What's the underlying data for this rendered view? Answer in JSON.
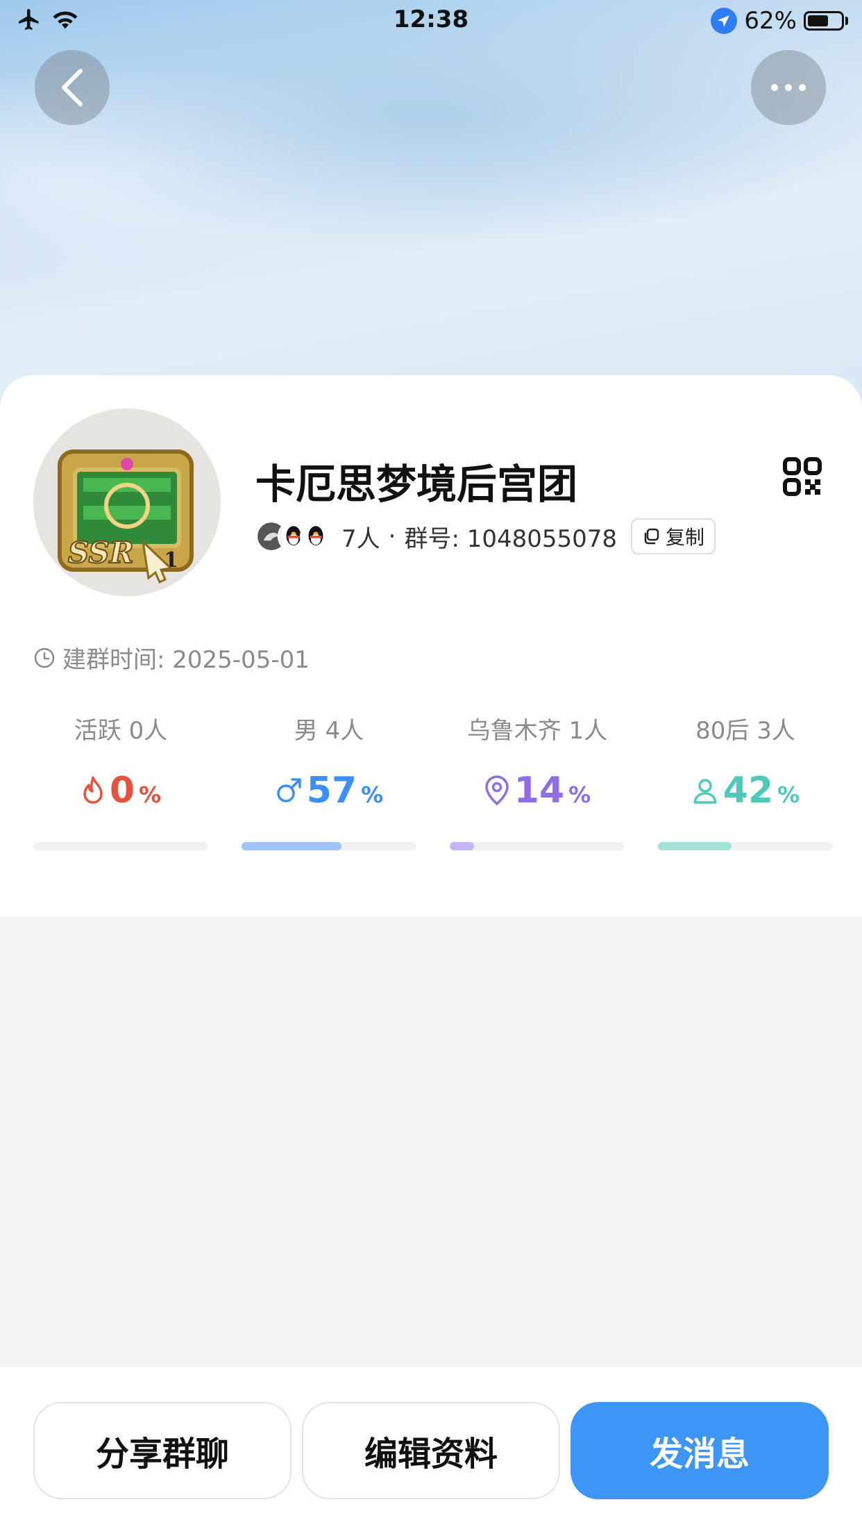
{
  "status_bar": {
    "time": "12:38",
    "battery": "62%",
    "battery_level": 0.62
  },
  "group": {
    "name": "卡厄思梦境后宫团",
    "member_count": "7人",
    "separator": "·",
    "group_id_label": "群号: 1048055078",
    "copy_label": "复制",
    "created_label": "建群时间: 2025-05-01",
    "avatar_badge": "SSR",
    "avatar_level": "1"
  },
  "stats": [
    {
      "label": "活跃 0人",
      "value": "0",
      "unit": "%",
      "icon": "fire-icon",
      "color": "#e5533d",
      "fill": 0.0
    },
    {
      "label": "男 4人",
      "value": "57",
      "unit": "%",
      "icon": "male-icon",
      "color": "#3d8ef5",
      "fill": 0.57,
      "bar_color": "#9fc2f7"
    },
    {
      "label": "乌鲁木齐 1人",
      "value": "14",
      "unit": "%",
      "icon": "location-pin-icon",
      "color": "#8e6ee6",
      "fill": 0.14,
      "bar_color": "#c6b5f4"
    },
    {
      "label": "80后 3人",
      "value": "42",
      "unit": "%",
      "icon": "person-icon",
      "color": "#4fcab8",
      "fill": 0.42,
      "bar_color": "#a4e2d8"
    }
  ],
  "actions": {
    "share": "分享群聊",
    "edit": "编辑资料",
    "send": "发消息"
  },
  "colors": {
    "primary": "#3d95f5"
  }
}
